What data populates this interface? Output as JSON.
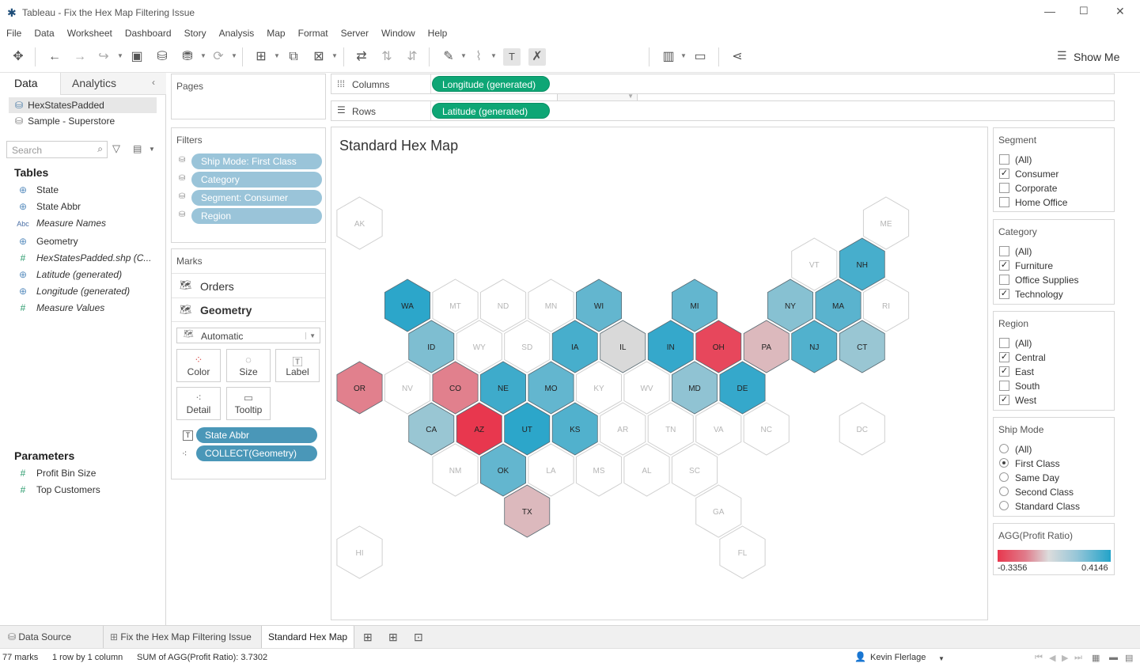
{
  "window": {
    "title": "Tableau - Fix the Hex Map Filtering Issue"
  },
  "menu": [
    "File",
    "Data",
    "Worksheet",
    "Dashboard",
    "Story",
    "Analysis",
    "Map",
    "Format",
    "Server",
    "Window",
    "Help"
  ],
  "toolbar": {
    "show_me": "Show Me"
  },
  "left_pane": {
    "tabs": {
      "data": "Data",
      "analytics": "Analytics"
    },
    "sources": [
      "HexStatesPadded",
      "Sample - Superstore"
    ],
    "search_placeholder": "Search",
    "tables_title": "Tables",
    "fields": [
      {
        "label": "State",
        "icon": "globe-icon",
        "italic": false
      },
      {
        "label": "State Abbr",
        "icon": "globe-icon",
        "italic": false
      },
      {
        "label": "Measure Names",
        "icon": "abc-icon",
        "italic": true
      },
      {
        "label": "Geometry",
        "icon": "globe-icon",
        "italic": false
      },
      {
        "label": "HexStatesPadded.shp (C...",
        "icon": "hash-icon",
        "italic": true
      },
      {
        "label": "Latitude (generated)",
        "icon": "globe-icon",
        "italic": true
      },
      {
        "label": "Longitude (generated)",
        "icon": "globe-icon",
        "italic": true
      },
      {
        "label": "Measure Values",
        "icon": "hash-icon",
        "italic": true
      }
    ],
    "parameters_title": "Parameters",
    "parameters": [
      "Profit Bin Size",
      "Top Customers"
    ]
  },
  "shelves": {
    "pages_label": "Pages",
    "filters_label": "Filters",
    "filters": [
      "Ship Mode: First Class",
      "Category",
      "Segment: Consumer",
      "Region"
    ],
    "marks_label": "Marks",
    "layers": [
      "Orders",
      "Geometry"
    ],
    "mark_type": "Automatic",
    "mark_buttons": [
      "Color",
      "Size",
      "Label",
      "Detail",
      "Tooltip"
    ],
    "mark_pills": [
      "State Abbr",
      "COLLECT(Geometry)"
    ],
    "columns_label": "Columns",
    "columns_pill": "Longitude (generated)",
    "rows_label": "Rows",
    "rows_pill": "Latitude (generated)"
  },
  "viz": {
    "title": "Standard Hex Map"
  },
  "hexmap": {
    "color_scale": {
      "neg": "#e8374e",
      "mid": "#d9d9d9",
      "pos": "#23a3c9",
      "empty": "#ffffff"
    },
    "states": [
      {
        "abbr": "AK",
        "row": 0,
        "col": 0,
        "c": null
      },
      {
        "abbr": "ME",
        "row": 0,
        "col": 11,
        "c": null
      },
      {
        "abbr": "VT",
        "row": 1,
        "col": 9,
        "c": null
      },
      {
        "abbr": "NH",
        "row": 1,
        "col": 10,
        "c": 0.8
      },
      {
        "abbr": "WA",
        "row": 2,
        "col": 1,
        "c": 0.95
      },
      {
        "abbr": "MT",
        "row": 2,
        "col": 2,
        "c": null
      },
      {
        "abbr": "ND",
        "row": 2,
        "col": 3,
        "c": null
      },
      {
        "abbr": "MN",
        "row": 2,
        "col": 4,
        "c": null
      },
      {
        "abbr": "WI",
        "row": 2,
        "col": 5,
        "c": 0.65
      },
      {
        "abbr": "MI",
        "row": 2,
        "col": 7,
        "c": 0.65
      },
      {
        "abbr": "NY",
        "row": 2,
        "col": 9,
        "c": 0.45
      },
      {
        "abbr": "MA",
        "row": 2,
        "col": 10,
        "c": 0.7
      },
      {
        "abbr": "RI",
        "row": 2,
        "col": 11,
        "c": null
      },
      {
        "abbr": "ID",
        "row": 3,
        "col": 1,
        "c": 0.5
      },
      {
        "abbr": "WY",
        "row": 3,
        "col": 2,
        "c": null
      },
      {
        "abbr": "SD",
        "row": 3,
        "col": 3,
        "c": null
      },
      {
        "abbr": "IA",
        "row": 3,
        "col": 4,
        "c": 0.8
      },
      {
        "abbr": "IL",
        "row": 3,
        "col": 5,
        "c": 0.0
      },
      {
        "abbr": "IN",
        "row": 3,
        "col": 6,
        "c": 0.9
      },
      {
        "abbr": "OH",
        "row": 3,
        "col": 7,
        "c": -0.9
      },
      {
        "abbr": "PA",
        "row": 3,
        "col": 8,
        "c": -0.2
      },
      {
        "abbr": "NJ",
        "row": 3,
        "col": 9,
        "c": 0.75
      },
      {
        "abbr": "CT",
        "row": 3,
        "col": 10,
        "c": 0.35
      },
      {
        "abbr": "OR",
        "row": 4,
        "col": 0,
        "c": -0.55
      },
      {
        "abbr": "NV",
        "row": 4,
        "col": 1,
        "c": null
      },
      {
        "abbr": "CO",
        "row": 4,
        "col": 2,
        "c": -0.55
      },
      {
        "abbr": "NE",
        "row": 4,
        "col": 3,
        "c": 0.85
      },
      {
        "abbr": "MO",
        "row": 4,
        "col": 4,
        "c": 0.65
      },
      {
        "abbr": "KY",
        "row": 4,
        "col": 5,
        "c": null
      },
      {
        "abbr": "WV",
        "row": 4,
        "col": 6,
        "c": null
      },
      {
        "abbr": "MD",
        "row": 4,
        "col": 7,
        "c": 0.4
      },
      {
        "abbr": "DE",
        "row": 4,
        "col": 8,
        "c": 0.9
      },
      {
        "abbr": "CA",
        "row": 5,
        "col": 1,
        "c": 0.35
      },
      {
        "abbr": "AZ",
        "row": 5,
        "col": 2,
        "c": -1.0
      },
      {
        "abbr": "UT",
        "row": 5,
        "col": 3,
        "c": 0.95
      },
      {
        "abbr": "KS",
        "row": 5,
        "col": 4,
        "c": 0.75
      },
      {
        "abbr": "AR",
        "row": 5,
        "col": 5,
        "c": null
      },
      {
        "abbr": "TN",
        "row": 5,
        "col": 6,
        "c": null
      },
      {
        "abbr": "VA",
        "row": 5,
        "col": 7,
        "c": null
      },
      {
        "abbr": "NC",
        "row": 5,
        "col": 8,
        "c": null
      },
      {
        "abbr": "DC",
        "row": 5,
        "col": 10,
        "c": null
      },
      {
        "abbr": "NM",
        "row": 6,
        "col": 2,
        "c": null
      },
      {
        "abbr": "OK",
        "row": 6,
        "col": 3,
        "c": 0.65
      },
      {
        "abbr": "LA",
        "row": 6,
        "col": 4,
        "c": null
      },
      {
        "abbr": "MS",
        "row": 6,
        "col": 5,
        "c": null
      },
      {
        "abbr": "AL",
        "row": 6,
        "col": 6,
        "c": null
      },
      {
        "abbr": "SC",
        "row": 6,
        "col": 7,
        "c": null
      },
      {
        "abbr": "TX",
        "row": 7,
        "col": 3,
        "c": -0.2
      },
      {
        "abbr": "GA",
        "row": 7,
        "col": 7,
        "c": null
      },
      {
        "abbr": "HI",
        "row": 8,
        "col": 0,
        "c": null
      },
      {
        "abbr": "FL",
        "row": 8,
        "col": 8,
        "c": null
      }
    ]
  },
  "filter_cards": {
    "segment": {
      "title": "Segment",
      "items": [
        {
          "label": "(All)",
          "checked": false
        },
        {
          "label": "Consumer",
          "checked": true
        },
        {
          "label": "Corporate",
          "checked": false
        },
        {
          "label": "Home Office",
          "checked": false
        }
      ]
    },
    "category": {
      "title": "Category",
      "items": [
        {
          "label": "(All)",
          "checked": false
        },
        {
          "label": "Furniture",
          "checked": true
        },
        {
          "label": "Office Supplies",
          "checked": false
        },
        {
          "label": "Technology",
          "checked": true
        }
      ]
    },
    "region": {
      "title": "Region",
      "items": [
        {
          "label": "(All)",
          "checked": false
        },
        {
          "label": "Central",
          "checked": true
        },
        {
          "label": "East",
          "checked": true
        },
        {
          "label": "South",
          "checked": false
        },
        {
          "label": "West",
          "checked": true
        }
      ]
    },
    "ship_mode": {
      "title": "Ship Mode",
      "items": [
        {
          "label": "(All)",
          "checked": false
        },
        {
          "label": "First Class",
          "checked": true
        },
        {
          "label": "Same Day",
          "checked": false
        },
        {
          "label": "Second Class",
          "checked": false
        },
        {
          "label": "Standard Class",
          "checked": false
        }
      ]
    }
  },
  "legend": {
    "title": "AGG(Profit Ratio)",
    "min": "-0.3356",
    "max": "0.4146"
  },
  "sheet_tabs": {
    "data_source": "Data Source",
    "tabs": [
      "Fix the Hex Map Filtering Issue",
      "Standard Hex Map"
    ],
    "active": "Standard Hex Map"
  },
  "status": {
    "marks": "77 marks",
    "dims": "1 row by 1 column",
    "sum": "SUM of AGG(Profit Ratio): 3.7302",
    "user": "Kevin Flerlage"
  }
}
